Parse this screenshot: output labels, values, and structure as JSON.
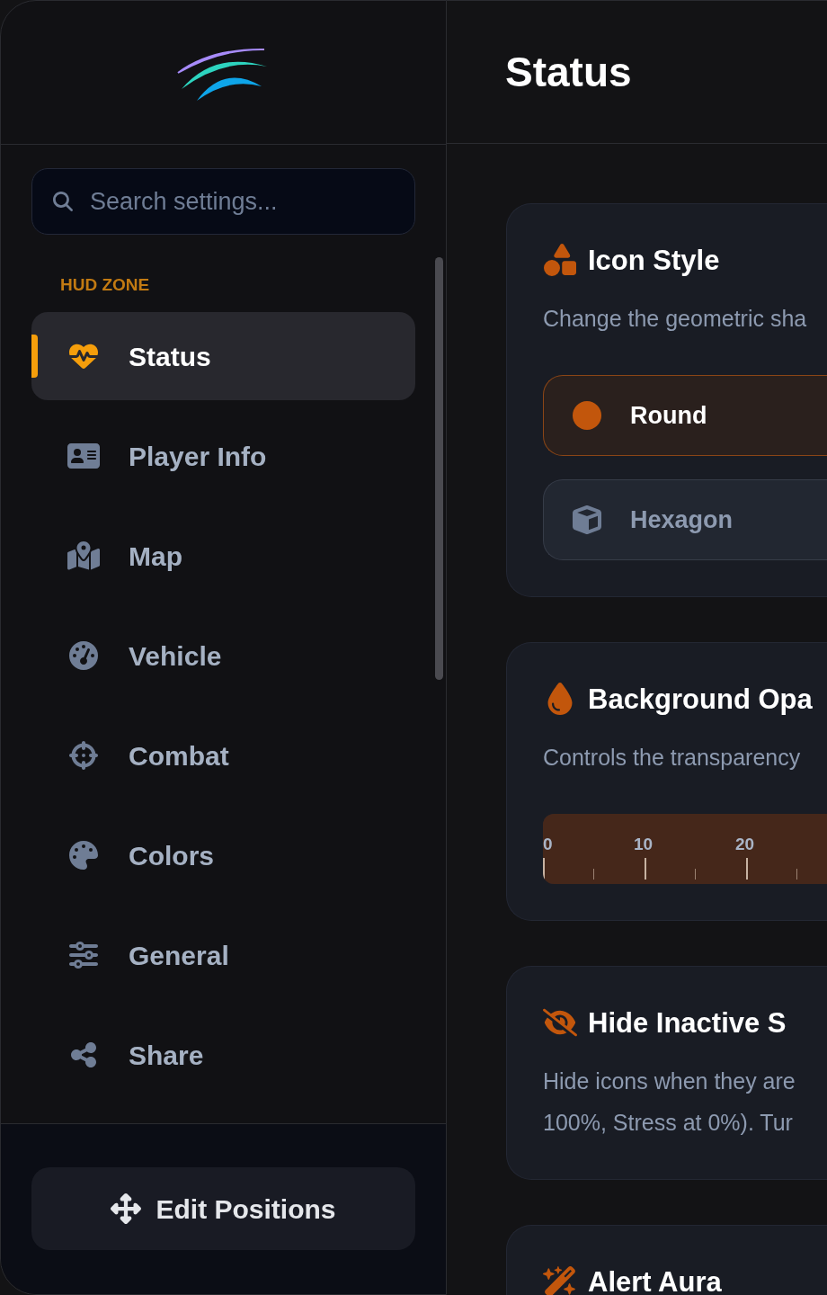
{
  "sidebar": {
    "search": {
      "placeholder": "Search settings..."
    },
    "section": "HUD ZONE",
    "items": [
      {
        "label": "Status",
        "selected": true
      },
      {
        "label": "Player Info",
        "selected": false
      },
      {
        "label": "Map",
        "selected": false
      },
      {
        "label": "Vehicle",
        "selected": false
      },
      {
        "label": "Combat",
        "selected": false
      },
      {
        "label": "Colors",
        "selected": false
      },
      {
        "label": "General",
        "selected": false
      },
      {
        "label": "Share",
        "selected": false
      }
    ],
    "footer_button": "Edit Positions"
  },
  "header": {
    "title": "Status"
  },
  "cards": [
    {
      "kind": "options",
      "title": "Icon Style",
      "description": [
        "Change the geometric sha"
      ],
      "options": [
        {
          "label": "Round",
          "selected": true
        },
        {
          "label": "Hexagon",
          "selected": false
        }
      ]
    },
    {
      "kind": "slider",
      "title": "Background Opa",
      "description": [
        "Controls the transparency"
      ],
      "ticks": [
        "0",
        "10",
        "20"
      ],
      "level": 1
    },
    {
      "kind": "text",
      "title": "Hide Inactive S",
      "description": [
        "Hide icons when they are",
        "100%, Stress at 0%). Tur"
      ]
    },
    {
      "kind": "text",
      "title": "Alert Aura"
    }
  ]
}
